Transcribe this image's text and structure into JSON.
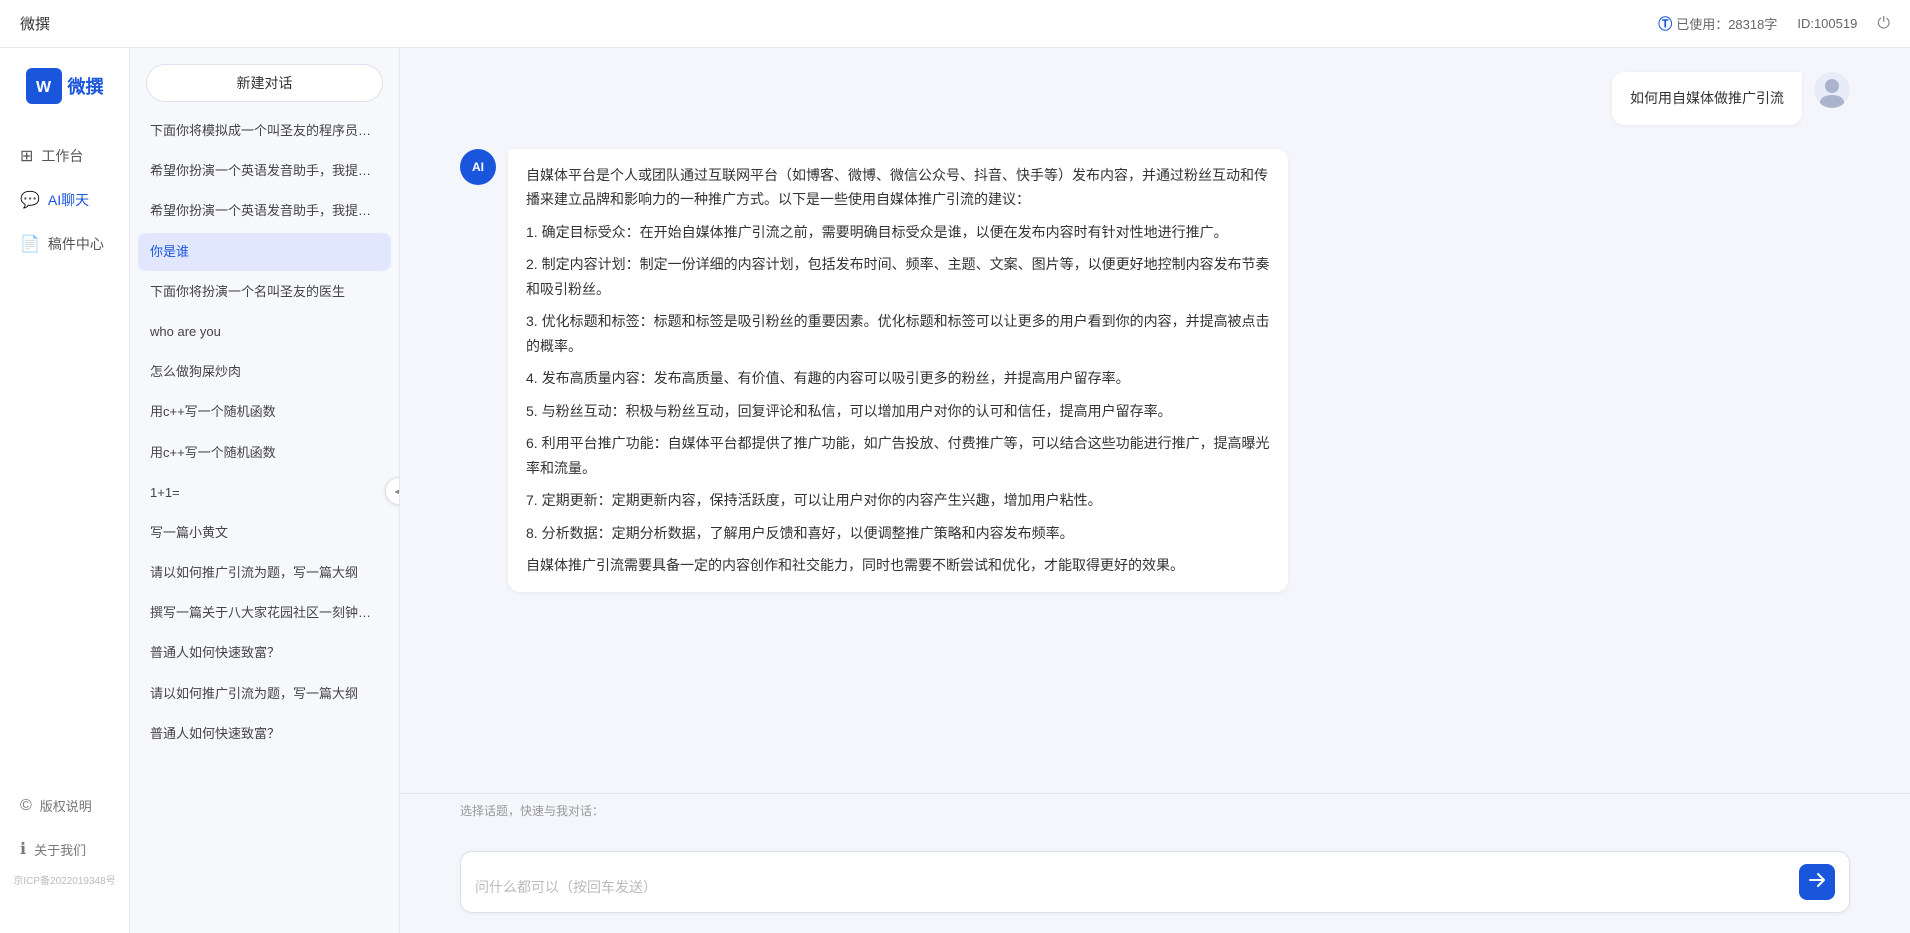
{
  "topbar": {
    "title": "微撰",
    "usage_label": "已使用：28318字",
    "usage_icon": "info-icon",
    "id_label": "ID:100519",
    "power_icon": "power-icon"
  },
  "logo": {
    "w": "W",
    "text": "微撰"
  },
  "nav": {
    "items": [
      {
        "id": "workbench",
        "icon": "⊞",
        "label": "工作台"
      },
      {
        "id": "ai-chat",
        "icon": "💬",
        "label": "AI聊天"
      },
      {
        "id": "drafts",
        "icon": "📄",
        "label": "稿件中心"
      }
    ],
    "bottom_items": [
      {
        "id": "copyright",
        "icon": "©",
        "label": "版权说明"
      },
      {
        "id": "about",
        "icon": "ℹ",
        "label": "关于我们"
      }
    ],
    "icp": "京ICP备2022019348号"
  },
  "conv_sidebar": {
    "new_btn": "新建对话",
    "conversations": [
      {
        "id": 1,
        "text": "下面你将模拟成一个叫圣友的程序员，我说..."
      },
      {
        "id": 2,
        "text": "希望你扮演一个英语发音助手，我提供给你..."
      },
      {
        "id": 3,
        "text": "希望你扮演一个英语发音助手，我提供给你..."
      },
      {
        "id": 4,
        "text": "你是谁",
        "active": true
      },
      {
        "id": 5,
        "text": "下面你将扮演一个名叫圣友的医生"
      },
      {
        "id": 6,
        "text": "who are you"
      },
      {
        "id": 7,
        "text": "怎么做狗屎炒肉"
      },
      {
        "id": 8,
        "text": "用c++写一个随机函数"
      },
      {
        "id": 9,
        "text": "用c++写一个随机函数"
      },
      {
        "id": 10,
        "text": "1+1="
      },
      {
        "id": 11,
        "text": "写一篇小黄文"
      },
      {
        "id": 12,
        "text": "请以如何推广引流为题，写一篇大纲"
      },
      {
        "id": 13,
        "text": "撰写一篇关于八大家花园社区一刻钟便民生..."
      },
      {
        "id": 14,
        "text": "普通人如何快速致富？"
      },
      {
        "id": 15,
        "text": "请以如何推广引流为题，写一篇大纲"
      },
      {
        "id": 16,
        "text": "普通人如何快速致富？"
      }
    ]
  },
  "chat": {
    "messages": [
      {
        "id": 1,
        "role": "user",
        "text": "如何用自媒体做推广引流"
      },
      {
        "id": 2,
        "role": "ai",
        "paragraphs": [
          "自媒体平台是个人或团队通过互联网平台（如博客、微博、微信公众号、抖音、快手等）发布内容，并通过粉丝互动和传播来建立品牌和影响力的一种推广方式。以下是一些使用自媒体推广引流的建议：",
          "1. 确定目标受众：在开始自媒体推广引流之前，需要明确目标受众是谁，以便在发布内容时有针对性地进行推广。",
          "2. 制定内容计划：制定一份详细的内容计划，包括发布时间、频率、主题、文案、图片等，以便更好地控制内容发布节奏和吸引粉丝。",
          "3. 优化标题和标签：标题和标签是吸引粉丝的重要因素。优化标题和标签可以让更多的用户看到你的内容，并提高被点击的概率。",
          "4. 发布高质量内容：发布高质量、有价值、有趣的内容可以吸引更多的粉丝，并提高用户留存率。",
          "5. 与粉丝互动：积极与粉丝互动，回复评论和私信，可以增加用户对你的认可和信任，提高用户留存率。",
          "6. 利用平台推广功能：自媒体平台都提供了推广功能，如广告投放、付费推广等，可以结合这些功能进行推广，提高曝光率和流量。",
          "7. 定期更新：定期更新内容，保持活跃度，可以让用户对你的内容产生兴趣，增加用户粘性。",
          "8. 分析数据：定期分析数据，了解用户反馈和喜好，以便调整推广策略和内容发布频率。",
          "自媒体推广引流需要具备一定的内容创作和社交能力，同时也需要不断尝试和优化，才能取得更好的效果。"
        ]
      }
    ],
    "input_placeholder": "问什么都可以（按回车发送）",
    "quick_topics_label": "选择话题，快速与我对话：",
    "quick_topics": []
  }
}
